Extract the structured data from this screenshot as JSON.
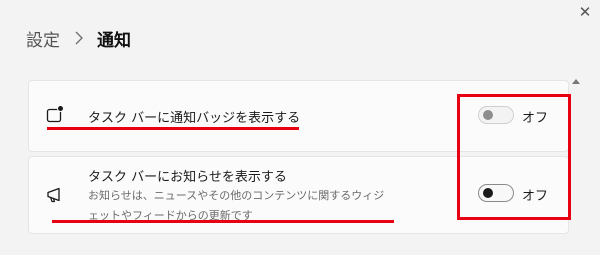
{
  "window": {
    "close_glyph": "✕"
  },
  "breadcrumb": {
    "parent": "設定",
    "separator_icon": "chevron-right-icon",
    "current": "通知"
  },
  "settings": [
    {
      "icon": "taskbar-badge-icon",
      "label": "タスク バーに通知バッジを表示する",
      "toggle_state": "off",
      "toggle_label": "オフ"
    },
    {
      "icon": "megaphone-icon",
      "label": "タスク バーにお知らせを表示する",
      "description_line1": "お知らせは、ニュースやその他のコンテンツに関するウィジ",
      "description_line2": "ェットやフィードからの更新です",
      "toggle_state": "off",
      "toggle_label": "オフ"
    }
  ],
  "colors": {
    "annotation_red": "#e60012",
    "background": "#f3f3f3",
    "card": "#fbfbfb"
  }
}
